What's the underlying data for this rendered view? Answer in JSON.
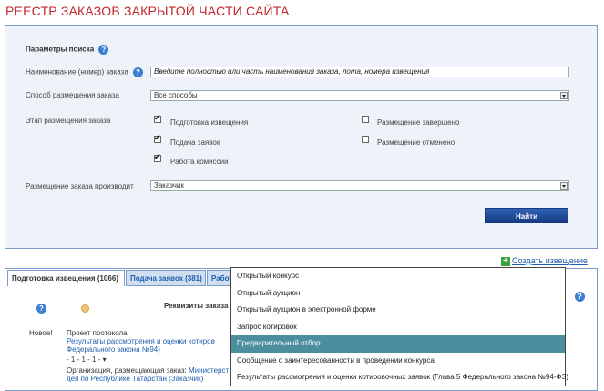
{
  "page_title": "РЕЕСТР ЗАКАЗОВ ЗАКРЫТОЙ ЧАСТИ САЙТА",
  "search": {
    "header": "Параметры поиска",
    "name_label": "Наименование (номер) заказа",
    "name_placeholder": "Введите полностью или часть наименования заказа, лота, номера извещения",
    "method_label": "Способ размещения заказа",
    "method_value": "Все способы",
    "stage_label": "Этап размещения заказа",
    "stages": [
      {
        "label": "Подготовка извещения",
        "checked": true
      },
      {
        "label": "Подача заявок",
        "checked": true
      },
      {
        "label": "Работа комиссии",
        "checked": true
      },
      {
        "label": "Размещение завершено",
        "checked": false
      },
      {
        "label": "Размещение отменено",
        "checked": false
      }
    ],
    "producer_label": "Размещение заказа производит",
    "producer_value": "Заказчик",
    "find_button": "Найти"
  },
  "create_link": "Создать извещение",
  "tabs": [
    {
      "label": "Подготовка извещения (1066)",
      "active": true
    },
    {
      "label": "Подача заявок (381)",
      "active": false
    },
    {
      "label": "Работ",
      "active": false
    }
  ],
  "table": {
    "col_requisites": "Реквизиты заказа"
  },
  "row": {
    "status": "Новое!",
    "title": "Проект протокола",
    "link1": "Результаты рассмотрения и оценки котиров",
    "link2": "Федерального закона №94)",
    "pager": "- 1 - 1 - 1 -",
    "org_label": "Организация, размещающая заказ:",
    "org_link": "Министерст",
    "org_line2": "деп по Республике Татарстан (Заказчик)"
  },
  "dropdown_items": [
    {
      "label": "Открытый конкурс",
      "selected": false
    },
    {
      "label": "Открытый аукцион",
      "selected": false
    },
    {
      "label": "Открытый аукцион в электронной форме",
      "selected": false
    },
    {
      "label": "Запрос котировок",
      "selected": false
    },
    {
      "label": "Предварительный отбор",
      "selected": true
    },
    {
      "label": "Сообщение о заинтересованности в проведении конкурса",
      "selected": false
    },
    {
      "label": "Результаты рассмотрения и оценки котировочных заявок (Глава 5 Федерального закона №94-ФЗ)",
      "selected": false
    }
  ],
  "colors": {
    "title": "#c1272d",
    "accent": "#1f5fad",
    "selected_row": "#4c8e9e"
  }
}
